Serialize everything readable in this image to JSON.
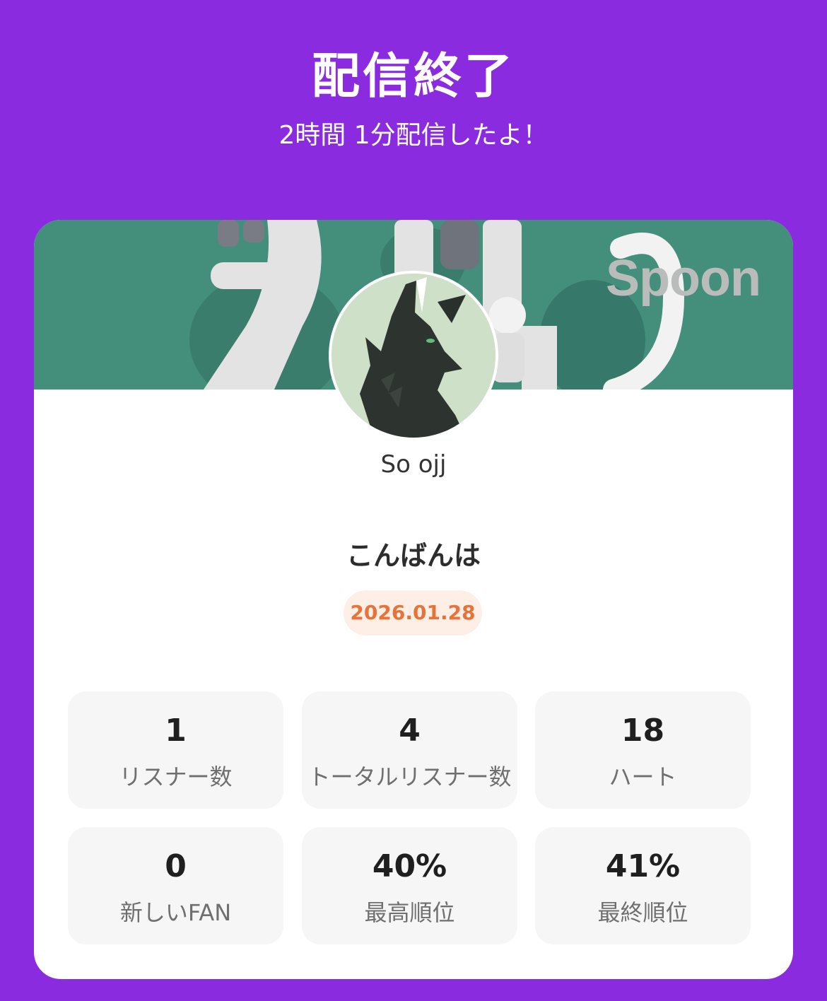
{
  "header": {
    "title": "配信終了",
    "subtitle": "2時間 1分配信したよ！"
  },
  "card": {
    "banner": {
      "brand": "Spoon",
      "accent_color": "#438f7c"
    },
    "profile": {
      "username": "So ojj"
    },
    "broadcast_title": "こんばんは",
    "date": "2026.01.28",
    "stats": [
      {
        "value": "1",
        "label": "リスナー数"
      },
      {
        "value": "4",
        "label": "トータルリスナー数"
      },
      {
        "value": "18",
        "label": "ハート"
      },
      {
        "value": "0",
        "label": "新しいFAN"
      },
      {
        "value": "40%",
        "label": "最高順位"
      },
      {
        "value": "41%",
        "label": "最終順位"
      }
    ]
  },
  "colors": {
    "background": "#8a2be0",
    "date_text": "#e5733a",
    "date_bg": "#fdeee6"
  }
}
